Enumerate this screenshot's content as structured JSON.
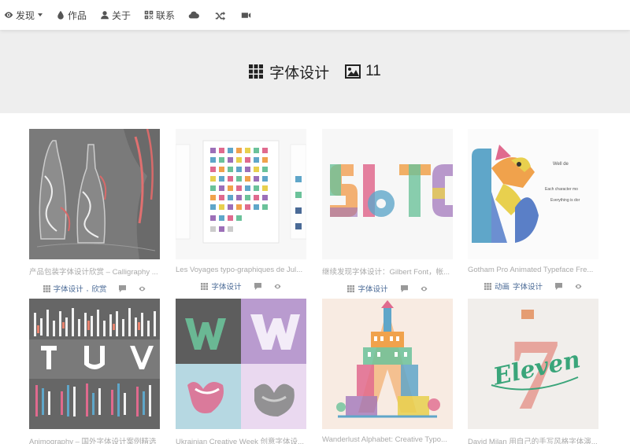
{
  "nav": {
    "discover": "发现",
    "works": "作品",
    "about": "关于",
    "contact": "联系"
  },
  "banner": {
    "category": "字体设计",
    "count": "11"
  },
  "cards": [
    {
      "caption": "产品包装字体设计欣赏 – Calligraphy ...",
      "tags": [
        "字体设计",
        "欣赏"
      ]
    },
    {
      "caption": "Les Voyages typo-graphiques de Jul...",
      "tags": [
        "字体设计"
      ]
    },
    {
      "caption": "继续发现字体设计：Gilbert Font，帐...",
      "tags": [
        "字体设计"
      ]
    },
    {
      "caption": "Gotham Pro Animated Typeface Fre...",
      "tags": [
        "动画",
        "字体设计"
      ]
    },
    {
      "caption": "Animography – 国外字体设计案例精选",
      "tags": []
    },
    {
      "caption": "Ukrainian Creative Week 创意字体设...",
      "tags": []
    },
    {
      "caption": "Wanderlust Alphabet: Creative Typo...",
      "tags": []
    },
    {
      "caption": "David Milan 用自己的手写风格字体演...",
      "tags": []
    }
  ],
  "thumb_text": {
    "card4_line1": "Well de",
    "card4_line2": "Each character mo",
    "card4_line3": "Everything is dor",
    "card8_word": "Eleven",
    "card8_numeral": "7"
  },
  "colors": {
    "tag_link": "#4a6a96",
    "banner_bg": "#eeeeee"
  }
}
